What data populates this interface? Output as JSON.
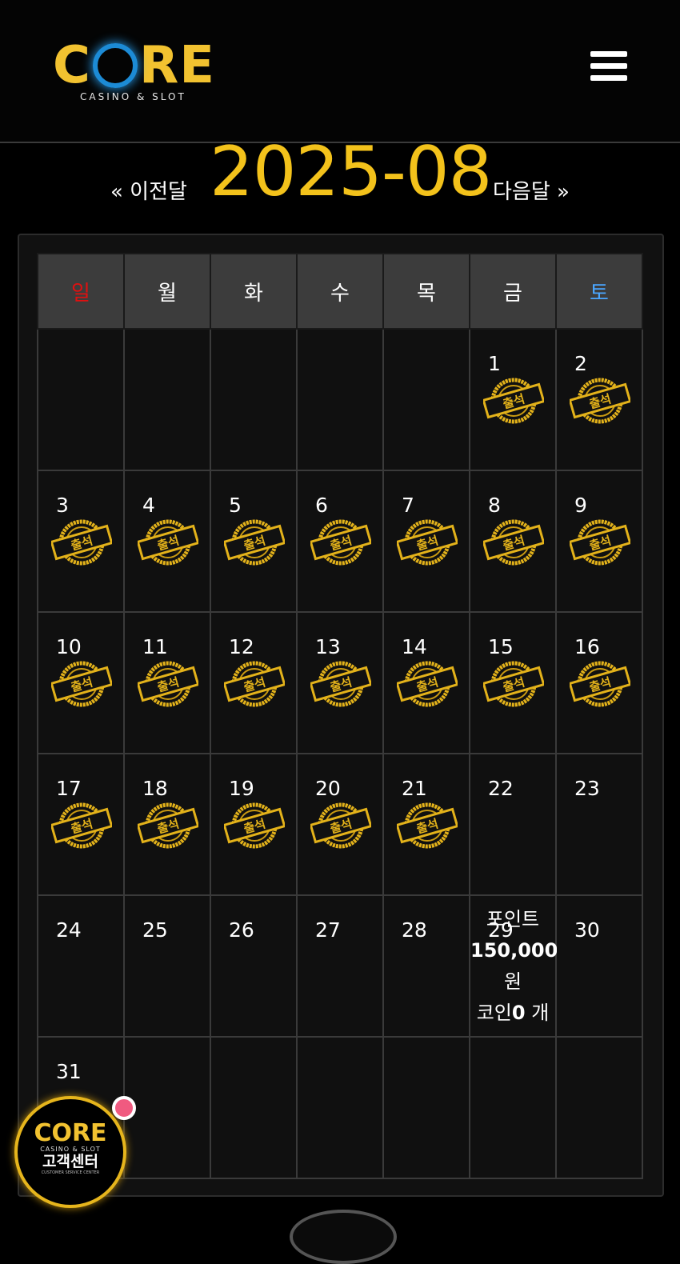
{
  "brand": {
    "logo": "CORE",
    "logo_sub": "CASINO & SLOT"
  },
  "nav": {
    "prev": "« 이전달",
    "month": "2025-08",
    "next": "다음달 »"
  },
  "weekdays": [
    "일",
    "월",
    "화",
    "수",
    "목",
    "금",
    "토"
  ],
  "stamp_text": "출석",
  "weeks": [
    [
      null,
      null,
      null,
      null,
      null,
      {
        "day": "1",
        "stamp": true
      },
      {
        "day": "2",
        "stamp": true
      }
    ],
    [
      {
        "day": "3",
        "stamp": true
      },
      {
        "day": "4",
        "stamp": true
      },
      {
        "day": "5",
        "stamp": true
      },
      {
        "day": "6",
        "stamp": true
      },
      {
        "day": "7",
        "stamp": true
      },
      {
        "day": "8",
        "stamp": true
      },
      {
        "day": "9",
        "stamp": true
      }
    ],
    [
      {
        "day": "10",
        "stamp": true
      },
      {
        "day": "11",
        "stamp": true
      },
      {
        "day": "12",
        "stamp": true
      },
      {
        "day": "13",
        "stamp": true
      },
      {
        "day": "14",
        "stamp": true
      },
      {
        "day": "15",
        "stamp": true
      },
      {
        "day": "16",
        "stamp": true
      }
    ],
    [
      {
        "day": "17",
        "stamp": true
      },
      {
        "day": "18",
        "stamp": true
      },
      {
        "day": "19",
        "stamp": true
      },
      {
        "day": "20",
        "stamp": true
      },
      {
        "day": "21",
        "stamp": true
      },
      {
        "day": "22",
        "stamp": false
      },
      {
        "day": "23",
        "stamp": false
      }
    ],
    [
      {
        "day": "24",
        "stamp": false
      },
      {
        "day": "25",
        "stamp": false
      },
      {
        "day": "26",
        "stamp": false
      },
      {
        "day": "27",
        "stamp": false
      },
      {
        "day": "28",
        "stamp": false
      },
      {
        "day": "29",
        "stamp": false,
        "points": true
      },
      {
        "day": "30",
        "stamp": false
      }
    ],
    [
      {
        "day": "31",
        "stamp": false
      },
      null,
      null,
      null,
      null,
      null,
      null
    ]
  ],
  "points_box": {
    "label": "포인트",
    "amount": "150,000",
    "unit": "원",
    "coin_label": "코인",
    "coin_value": "0",
    "coin_unit": "개"
  },
  "cs": {
    "logo": "CORE",
    "sub": "CASINO & SLOT",
    "title": "고객센터",
    "tiny": "CUSTOMER SERVICE CENTER"
  },
  "colors": {
    "accent": "#f3c21b",
    "sunday": "#e01010",
    "saturday": "#4aa6ff",
    "stamp_gold": "#e3b21a"
  },
  "icons": {
    "menu": "hamburger-menu-icon",
    "stamp": "attendance-stamp-icon"
  }
}
